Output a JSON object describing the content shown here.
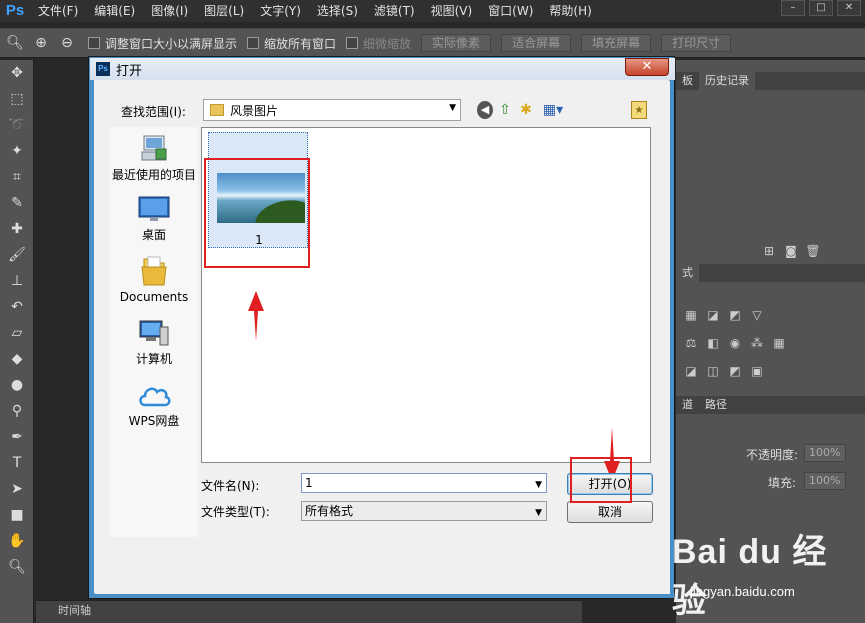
{
  "app": {
    "logo": "Ps"
  },
  "menubar": {
    "items": [
      "文件(F)",
      "编辑(E)",
      "图像(I)",
      "图层(L)",
      "文字(Y)",
      "选择(S)",
      "滤镜(T)",
      "视图(V)",
      "窗口(W)",
      "帮助(H)"
    ]
  },
  "optionsbar": {
    "resize_windows": "调整窗口大小以满屏显示",
    "zoom_all": "缩放所有窗口",
    "scrubby_zoom": "细微缩放",
    "actual_pixels": "实际像素",
    "fit_screen": "适合屏幕",
    "fill_screen": "填充屏幕",
    "print_size": "打印尺寸"
  },
  "rightpanel": {
    "tab_partial": "板",
    "tab_history": "历史记录",
    "tab_styles_partial": "式",
    "tab_channels_partial": "道",
    "tab_paths": "路径",
    "opacity_label": "不透明度:",
    "opacity_value": "100%",
    "fill_label": "填充:",
    "fill_value": "100%"
  },
  "timeline": {
    "label": "时间轴"
  },
  "dialog": {
    "title": "打开",
    "close_symbol": "✕",
    "lookin_label": "查找范围(I):",
    "lookin_value": "风景图片",
    "places": [
      {
        "label": "最近使用的项目"
      },
      {
        "label": "桌面"
      },
      {
        "label": "Documents"
      },
      {
        "label": "计算机"
      },
      {
        "label": "WPS网盘"
      }
    ],
    "file_item": "1",
    "filename_label": "文件名(N):",
    "filename_value": "1",
    "filetype_label": "文件类型(T):",
    "filetype_value": "所有格式",
    "open_button": "打开(O)",
    "cancel_button": "取消"
  },
  "watermark": {
    "logo": "Bai du 经验",
    "url": "jingyan.baidu.com"
  },
  "colors": {
    "accent_red": "#e02020",
    "dialog_border": "#4a90c8",
    "ps_blue": "#3ea3ff"
  }
}
